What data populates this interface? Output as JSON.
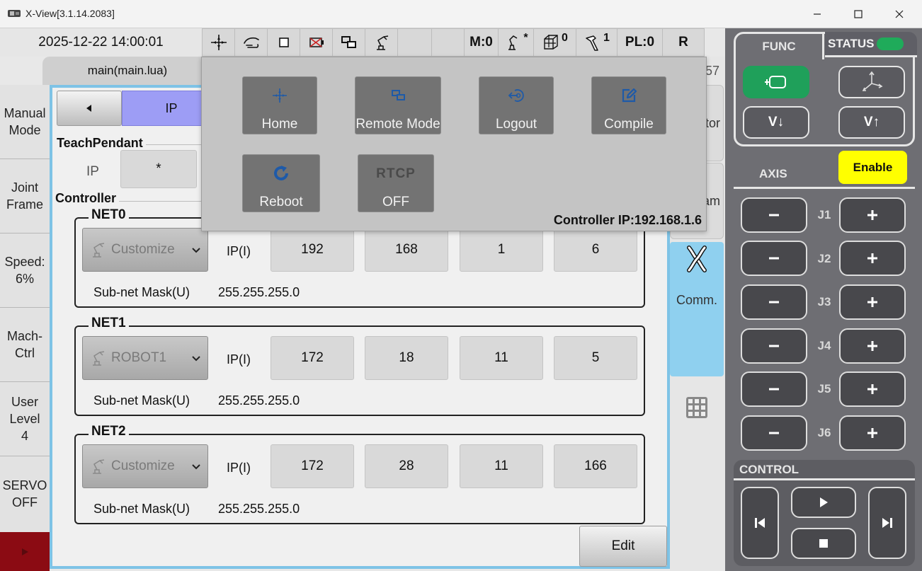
{
  "window": {
    "title": "X-View[3.1.14.2083]"
  },
  "header": {
    "datetime": "2025-12-22 14:00:01",
    "mode_counter": "M:0",
    "tool_indicator": "*",
    "frame_indicator": "0",
    "hammer_indicator": "1",
    "pl": "PL:0",
    "r": "R"
  },
  "file_tab": {
    "label": "main(main.lua)"
  },
  "left_sidebar": {
    "items": [
      {
        "label": "Manual Mode"
      },
      {
        "label": "Joint Frame"
      },
      {
        "label": "Speed: 6%"
      },
      {
        "label": "Mach-Ctrl"
      },
      {
        "label": "User Level 4"
      },
      {
        "label": "SERVO OFF"
      }
    ]
  },
  "main": {
    "ip_tab": "IP",
    "teach_pendant": {
      "label": "TeachPendant",
      "ip_label": "IP",
      "ip_value": "*"
    },
    "controller_label": "Controller",
    "nets": [
      {
        "name": "NET0",
        "mode": "Customize",
        "ip_label": "IP(I)",
        "ip": [
          "192",
          "168",
          "1",
          "6"
        ],
        "mask_label": "Sub-net Mask(U)",
        "mask": "255.255.255.0"
      },
      {
        "name": "NET1",
        "mode": "ROBOT1",
        "ip_label": "IP(I)",
        "ip": [
          "172",
          "18",
          "11",
          "5"
        ],
        "mask_label": "Sub-net Mask(U)",
        "mask": "255.255.255.0"
      },
      {
        "name": "NET2",
        "mode": "Customize",
        "ip_label": "IP(I)",
        "ip": [
          "172",
          "28",
          "11",
          "166"
        ],
        "mask_label": "Sub-net Mask(U)",
        "mask": "255.255.255.0"
      }
    ],
    "edit_label": "Edit"
  },
  "popup": {
    "buttons": [
      {
        "label": "Home",
        "icon": "crosshair-icon"
      },
      {
        "label": "Remote Mode",
        "icon": "remote-icon"
      },
      {
        "label": "Logout",
        "icon": "logout-icon"
      },
      {
        "label": "Compile",
        "icon": "edit-icon"
      },
      {
        "label": "Reboot",
        "icon": "refresh-icon"
      },
      {
        "title": "RTCP",
        "label": "OFF"
      }
    ],
    "controller_ip": "Controller IP:192.168.1.6"
  },
  "right_tabs": {
    "partial_text_top": "57",
    "partial_tab_1": "tor",
    "partial_tab_2": "am",
    "comm_label": "Comm."
  },
  "right_panel": {
    "func_label": "FUNC",
    "status_label": "STATUS",
    "status_color": "#1fab5a",
    "v_down": "V↓",
    "v_up": "V↑",
    "axis_label": "AXIS",
    "enable_label": "Enable",
    "enable_color": "#ffff00",
    "joints": [
      "J1",
      "J2",
      "J3",
      "J4",
      "J5",
      "J6"
    ],
    "control_label": "CONTROL"
  }
}
